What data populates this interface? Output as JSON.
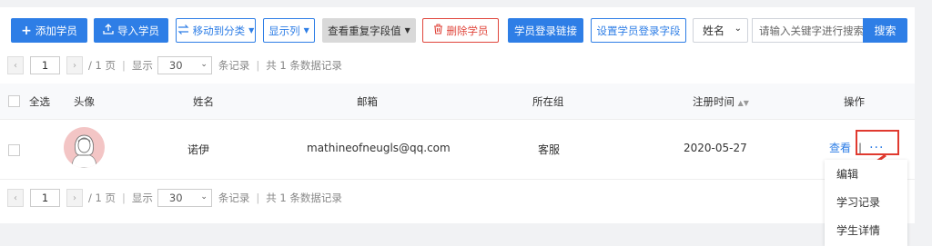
{
  "toolbar": {
    "add_label": "添加学员",
    "import_label": "导入学员",
    "move_label": "移动到分类",
    "columns_label": "显示列",
    "duplicates_label": "查看重复字段值",
    "delete_label": "删除学员",
    "login_link_label": "学员登录链接",
    "login_fields_label": "设置学员登录字段",
    "field_select_value": "姓名",
    "search_placeholder": "请输入关键字进行搜索",
    "search_button": "搜索"
  },
  "pager": {
    "current_page": "1",
    "page_total": "/ 1 页",
    "show_label": "显示",
    "page_size": "30",
    "per_page_suffix": "条记录",
    "total_text": "共 1 条数据记录"
  },
  "table": {
    "columns": {
      "select_all": "全选",
      "avatar": "头像",
      "name": "姓名",
      "email": "邮箱",
      "group": "所在组",
      "registered": "注册时间",
      "actions": "操作"
    },
    "rows": [
      {
        "name": "诺伊",
        "email": "mathineofneugls@qq.com",
        "group": "客服",
        "registered": "2020-05-27",
        "view_label": "查看",
        "more_label": "···"
      }
    ]
  },
  "dropdown_menu": {
    "items": [
      "编辑",
      "学习记录",
      "学生详情"
    ]
  },
  "colors": {
    "primary": "#2e7ee6",
    "danger": "#e0453b",
    "highlight": "#e03a2f"
  }
}
